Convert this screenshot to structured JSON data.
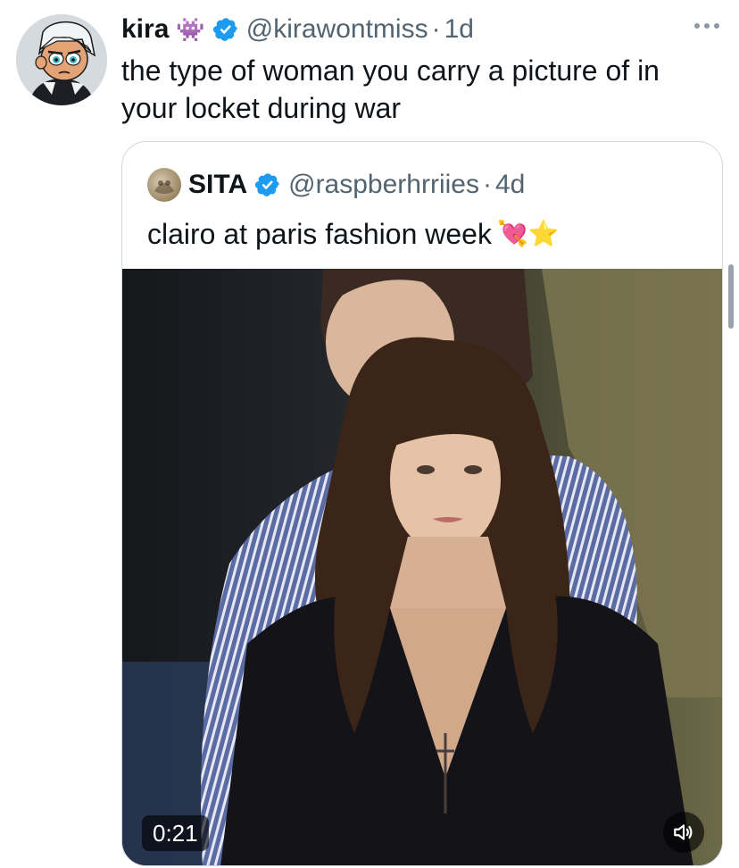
{
  "tweet": {
    "author_name": "kira",
    "author_handle": "@kirawontmiss",
    "separator": "·",
    "time": "1d",
    "text": "the type of woman you carry a picture of in your locket during war",
    "name_emoji": "👾"
  },
  "quote": {
    "author_name": "SITA",
    "author_handle": "@raspberhrriies",
    "separator": "·",
    "time": "4d",
    "text": "clairo at paris fashion week",
    "emojis": "💘⭐"
  },
  "video": {
    "duration": "0:21"
  },
  "colors": {
    "verified": "#1d9bf0",
    "secondary_text": "#536471",
    "border": "#cfd9de"
  },
  "icons": {
    "verified": "verified-badge-icon",
    "more": "more-options-icon",
    "mute": "speaker-icon"
  }
}
